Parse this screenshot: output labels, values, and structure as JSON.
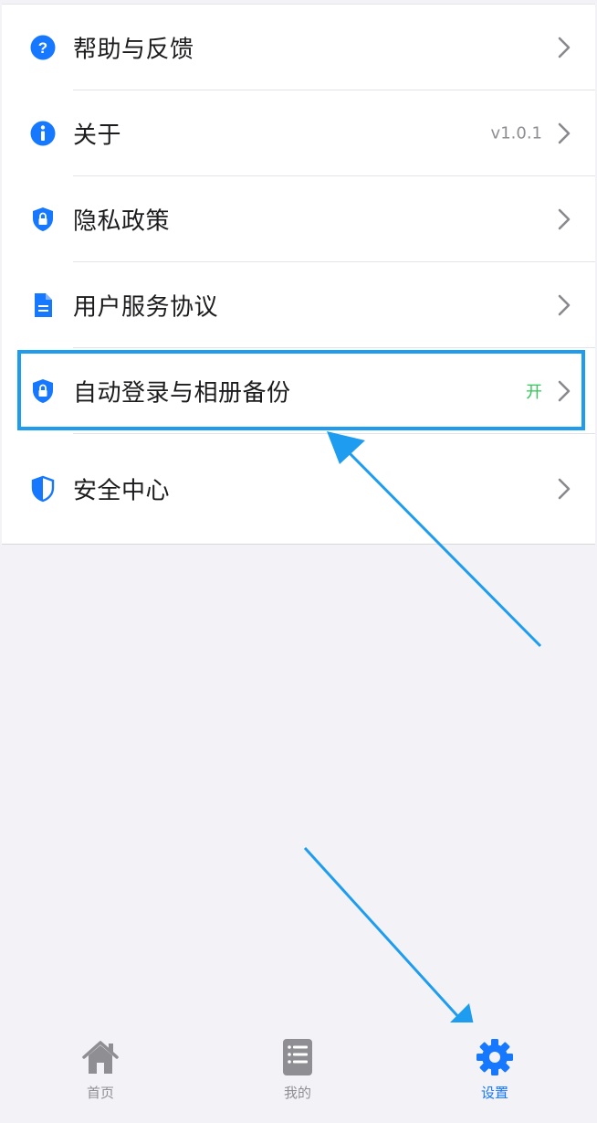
{
  "settings": {
    "items": [
      {
        "label": "帮助与反馈",
        "icon": "question-circle-icon",
        "value": ""
      },
      {
        "label": "关于",
        "icon": "info-circle-icon",
        "value": "v1.0.1"
      },
      {
        "label": "隐私政策",
        "icon": "shield-lock-icon",
        "value": ""
      },
      {
        "label": "用户服务协议",
        "icon": "document-icon",
        "value": ""
      },
      {
        "label": "自动登录与相册备份",
        "icon": "shield-lock-icon",
        "value": "开"
      },
      {
        "label": "安全中心",
        "icon": "shield-half-icon",
        "value": ""
      }
    ]
  },
  "tabbar": {
    "tabs": [
      {
        "label": "首页",
        "icon": "home-icon",
        "active": false
      },
      {
        "label": "我的",
        "icon": "list-note-icon",
        "active": false
      },
      {
        "label": "设置",
        "icon": "gear-icon",
        "active": true
      }
    ]
  },
  "colors": {
    "accent": "#1677ff",
    "on_value": "#34c759",
    "annotation": "#1e9df0",
    "icon_gray": "#8e8e93"
  }
}
